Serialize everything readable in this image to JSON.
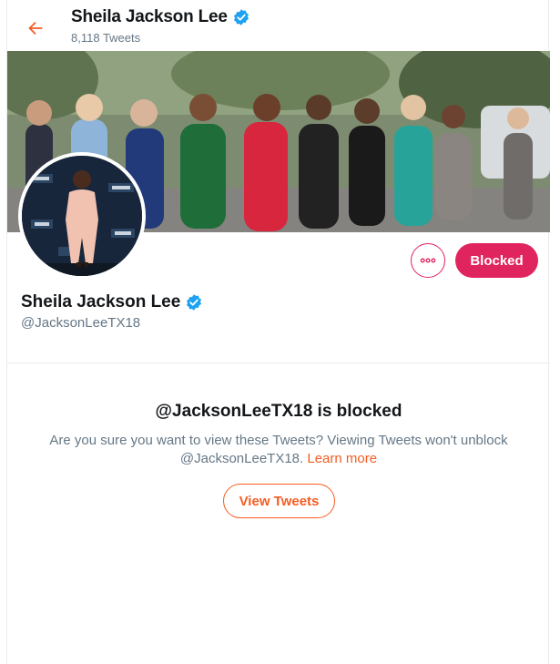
{
  "colors": {
    "accent": "#f45d22",
    "blocked": "#e0245e",
    "verified": "#1da1f2",
    "secondary_text": "#657786"
  },
  "header": {
    "back_icon": "back-arrow-icon",
    "name": "Sheila Jackson Lee",
    "tweet_count": "8,118 Tweets"
  },
  "profile": {
    "banner": "banner-photo",
    "avatar": "avatar-photo",
    "name": "Sheila Jackson Lee",
    "handle": "@JacksonLeeTX18",
    "verified_icon": "verified-badge-icon",
    "more_icon": "more-options-icon",
    "blocked_label": "Blocked"
  },
  "blocked_notice": {
    "title": "@JacksonLeeTX18 is blocked",
    "message": "Are you sure you want to view these Tweets? Viewing Tweets won't unblock @JacksonLeeTX18.",
    "learn_more": "Learn more",
    "view_tweets_label": "View Tweets"
  }
}
